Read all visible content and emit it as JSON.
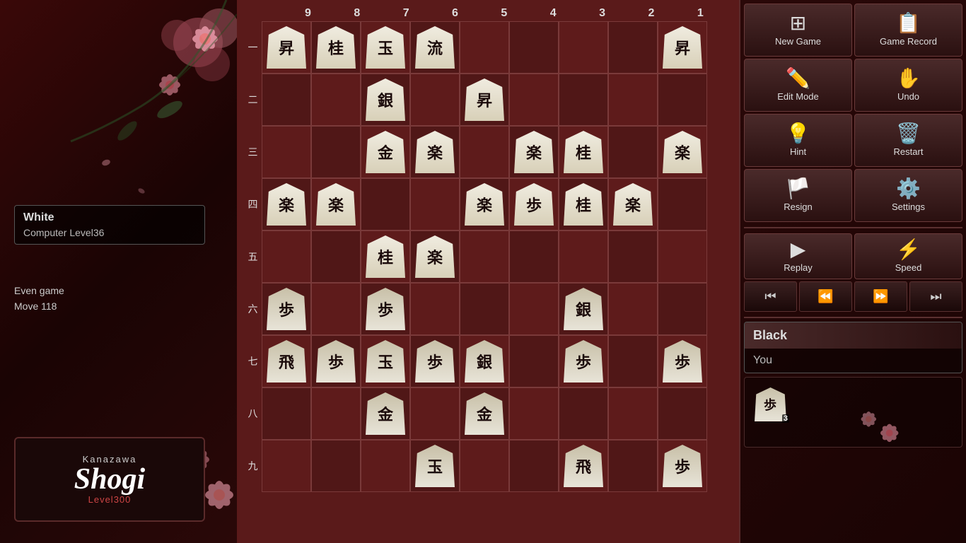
{
  "app": {
    "title": "Kanazawa Shogi Level 300"
  },
  "left_panel": {
    "white_player": {
      "color_label": "White",
      "level_label": "Computer Level36"
    },
    "game_status": {
      "line1": "Even game",
      "line2": "Move 118"
    },
    "logo": {
      "line1": "Kanazawa",
      "line2": "Shogi",
      "line3": "Level300"
    }
  },
  "right_panel": {
    "buttons": {
      "new_game": "New Game",
      "game_record": "Game Record",
      "edit_mode": "Edit Mode",
      "undo": "Undo",
      "hint": "Hint",
      "restart": "Restart",
      "resign": "Resign",
      "settings": "Settings"
    },
    "replay": {
      "label": "Replay",
      "speed_label": "Speed"
    },
    "black_player": {
      "color_label": "Black",
      "you_label": "You"
    },
    "captured": {
      "pawn_count": "3"
    }
  },
  "board": {
    "col_headers": [
      "9",
      "8",
      "7",
      "6",
      "5",
      "4",
      "3",
      "2",
      "1"
    ],
    "row_labels": [
      "一",
      "二",
      "三",
      "四",
      "五",
      "六",
      "七",
      "八",
      "九"
    ],
    "pieces": {
      "r0c0": {
        "char": "昇",
        "side": "white"
      },
      "r0c1": {
        "char": "桂",
        "side": "white"
      },
      "r0c2": {
        "char": "玉",
        "side": "white"
      },
      "r0c3": {
        "char": "流",
        "side": "white"
      },
      "r0c8": {
        "char": "昇",
        "side": "white"
      },
      "r1c0": {
        "char": "",
        "side": ""
      },
      "r1c2": {
        "char": "銀",
        "side": "white"
      },
      "r1c4": {
        "char": "昇",
        "side": "white"
      },
      "r2c2": {
        "char": "金",
        "side": "white"
      },
      "r2c3": {
        "char": "楽",
        "side": "white"
      },
      "r2c5": {
        "char": "楽",
        "side": "white"
      },
      "r2c6": {
        "char": "桂",
        "side": "white"
      },
      "r2c8": {
        "char": "楽",
        "side": "white"
      },
      "r3c0": {
        "char": "楽",
        "side": "white"
      },
      "r3c1": {
        "char": "楽",
        "side": "white"
      },
      "r3c4": {
        "char": "楽",
        "side": "white"
      },
      "r3c5": {
        "char": "歩",
        "side": "white"
      },
      "r3c6": {
        "char": "桂",
        "side": "white"
      },
      "r3c7": {
        "char": "楽",
        "side": "white"
      },
      "r4c2": {
        "char": "桂",
        "side": "white"
      },
      "r4c3": {
        "char": "楽",
        "side": "white"
      },
      "r5c0": {
        "char": "歩",
        "side": "black"
      },
      "r5c2": {
        "char": "歩",
        "side": "black"
      },
      "r5c6": {
        "char": "銀",
        "side": "black"
      },
      "r6c0": {
        "char": "飛",
        "side": "black"
      },
      "r6c1": {
        "char": "歩",
        "side": "black"
      },
      "r6c2": {
        "char": "玉",
        "side": "black"
      },
      "r6c3": {
        "char": "歩",
        "side": "black"
      },
      "r6c4": {
        "char": "銀",
        "side": "black"
      },
      "r6c6": {
        "char": "歩",
        "side": "black"
      },
      "r6c8": {
        "char": "歩",
        "side": "black"
      },
      "r7c2": {
        "char": "金",
        "side": "black"
      },
      "r7c4": {
        "char": "金",
        "side": "black"
      },
      "r8c3": {
        "char": "玉",
        "side": "black"
      },
      "r8c6": {
        "char": "飛",
        "side": "black"
      },
      "r8c8": {
        "char": "歩",
        "side": "black"
      }
    }
  },
  "colors": {
    "bg_dark": "#2a0808",
    "bg_medium": "#5a1a1a",
    "panel_bg": "#1a0404",
    "btn_bg": "#4a2a2a",
    "btn_border": "#6a3a3a",
    "text_light": "#dddddd",
    "text_medium": "#bbbbbb",
    "accent_red": "#cc4444"
  }
}
